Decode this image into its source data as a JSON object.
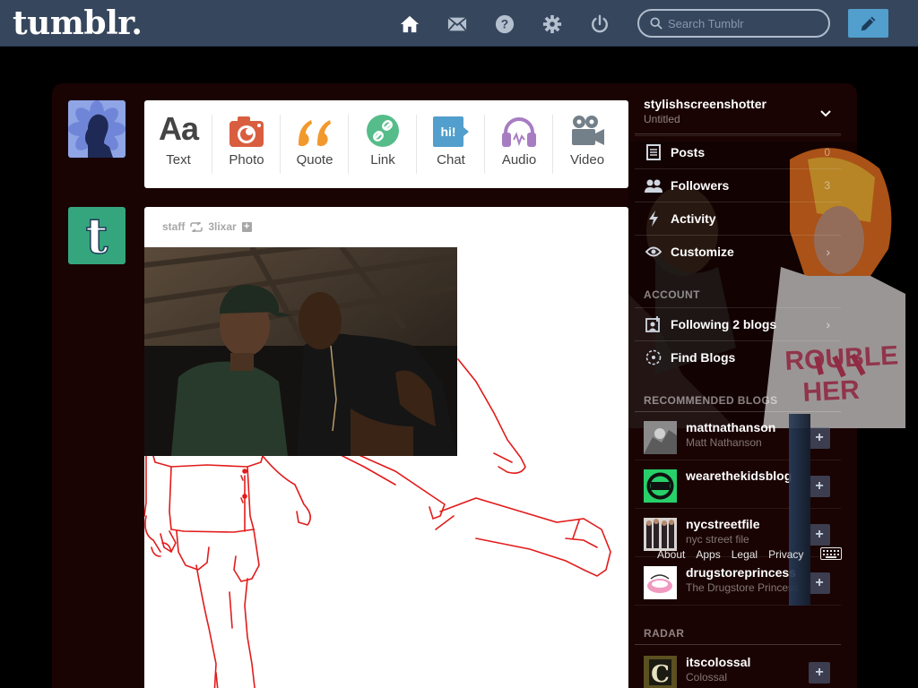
{
  "topbar": {
    "logo": "tumblr.",
    "search_placeholder": "Search Tumblr",
    "icons": [
      "home-icon",
      "mail-icon",
      "help-icon",
      "settings-icon",
      "power-icon"
    ]
  },
  "post_types": [
    {
      "label": "Text",
      "icon": "text-icon"
    },
    {
      "label": "Photo",
      "icon": "camera-icon"
    },
    {
      "label": "Quote",
      "icon": "quote-icon"
    },
    {
      "label": "Link",
      "icon": "link-icon"
    },
    {
      "label": "Chat",
      "icon": "chat-icon"
    },
    {
      "label": "Audio",
      "icon": "headphones-icon"
    },
    {
      "label": "Video",
      "icon": "video-camera-icon"
    }
  ],
  "post_type_glyphs": {
    "text": "Aa",
    "chat": "hi!"
  },
  "post": {
    "author": "staff",
    "reblogged_from": "3lixar"
  },
  "sidebar": {
    "blog_name": "stylishscreenshotter",
    "blog_title": "Untitled",
    "menu": [
      {
        "label": "Posts",
        "count": "0"
      },
      {
        "label": "Followers",
        "count": "3"
      },
      {
        "label": "Activity",
        "count": ""
      },
      {
        "label": "Customize",
        "count": ""
      }
    ],
    "account_heading": "ACCOUNT",
    "account_items": [
      {
        "label": "Following 2 blogs"
      },
      {
        "label": "Find Blogs"
      }
    ],
    "recommended_heading": "RECOMMENDED BLOGS",
    "recommended": [
      {
        "name": "mattnathanson",
        "title": "Matt Nathanson"
      },
      {
        "name": "wearethekidsblog",
        "title": ""
      },
      {
        "name": "nycstreetfile",
        "title": "nyc street file"
      },
      {
        "name": "drugstoreprincess",
        "title": "The Drugstore Princess"
      }
    ],
    "radar_heading": "RADAR",
    "radar": [
      {
        "name": "itscolossal",
        "title": "Colossal"
      }
    ],
    "footer": [
      "About",
      "Apps",
      "Legal",
      "Privacy"
    ]
  },
  "colors": {
    "topbar": "#36465d",
    "compose": "#529ecc",
    "dashboard": "#1a0303",
    "quote": "#f2992e",
    "photo": "#d95e40",
    "link": "#56bc8a",
    "chat": "#529ecc",
    "audio": "#a77dc2",
    "video": "#748089",
    "drawing": "#e21b1b"
  }
}
